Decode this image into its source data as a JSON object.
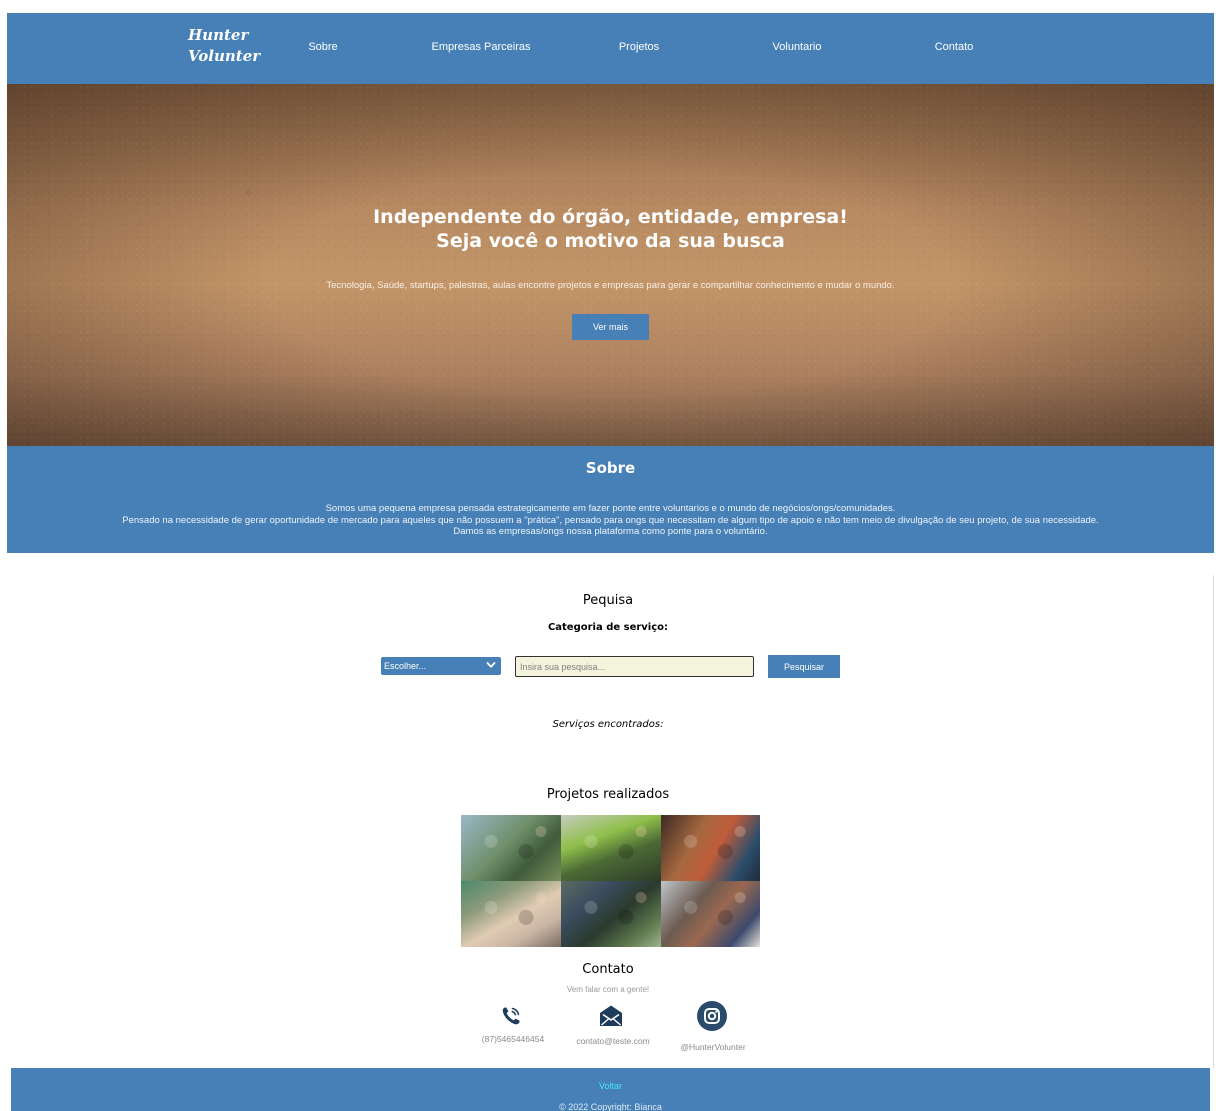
{
  "header": {
    "logo_line1": "Hunter",
    "logo_line2": "Volunter",
    "nav": [
      "Sobre",
      "Empresas Parceiras",
      "Projetos",
      "Voluntario",
      "Contato"
    ]
  },
  "hero": {
    "title_line1": "Independente do órgão, entidade, empresa!",
    "title_line2": "Seja você o motivo da sua busca",
    "subtitle": "Tecnologia, Saúde, startups, palestras, aulas encontre projetos e empresas para gerar e compartilhar conhecimento e mudar o mundo.",
    "button": "Ver mais"
  },
  "sobre": {
    "title": "Sobre",
    "paragraphs": [
      "Somos uma pequena empresa pensada estrategicamente em fazer ponte entre voluntarios e o mundo de negócios/ongs/comunidades.",
      "Pensado na necessidade de gerar oportunidade de mercado para aqueles que não possuem a \"prática\", pensado para ongs que necessitam de algum tipo de apoio e não tem meio de divulgação de seu projeto, de sua necessidade.",
      "Damos as empresas/ongs nossa plataforma como ponte para o voluntário."
    ]
  },
  "pesquisa": {
    "title": "Pequisa",
    "category_label": "Categoria de serviço:",
    "select_value": "Escolher...",
    "input_placeholder": "Insira sua pesquisa...",
    "button": "Pesquisar",
    "found_label": "Serviços encontrados:"
  },
  "projetos": {
    "title": "Projetos realizados"
  },
  "contato": {
    "title": "Contato",
    "subtitle": "Vem falar com a gente!",
    "phone": "(87)5465446454",
    "email": "contato@teste.com",
    "instagram": "@HunterVolunter",
    "icons": [
      "phone-icon",
      "mail-icon",
      "instagram-icon"
    ]
  },
  "footer": {
    "link": "Voltar",
    "copyright": "© 2022 Copyright: Bianca"
  },
  "colors": {
    "primary": "#4680b7",
    "footer_link": "#4ee6f0",
    "input_bg": "#f4f4dd"
  }
}
